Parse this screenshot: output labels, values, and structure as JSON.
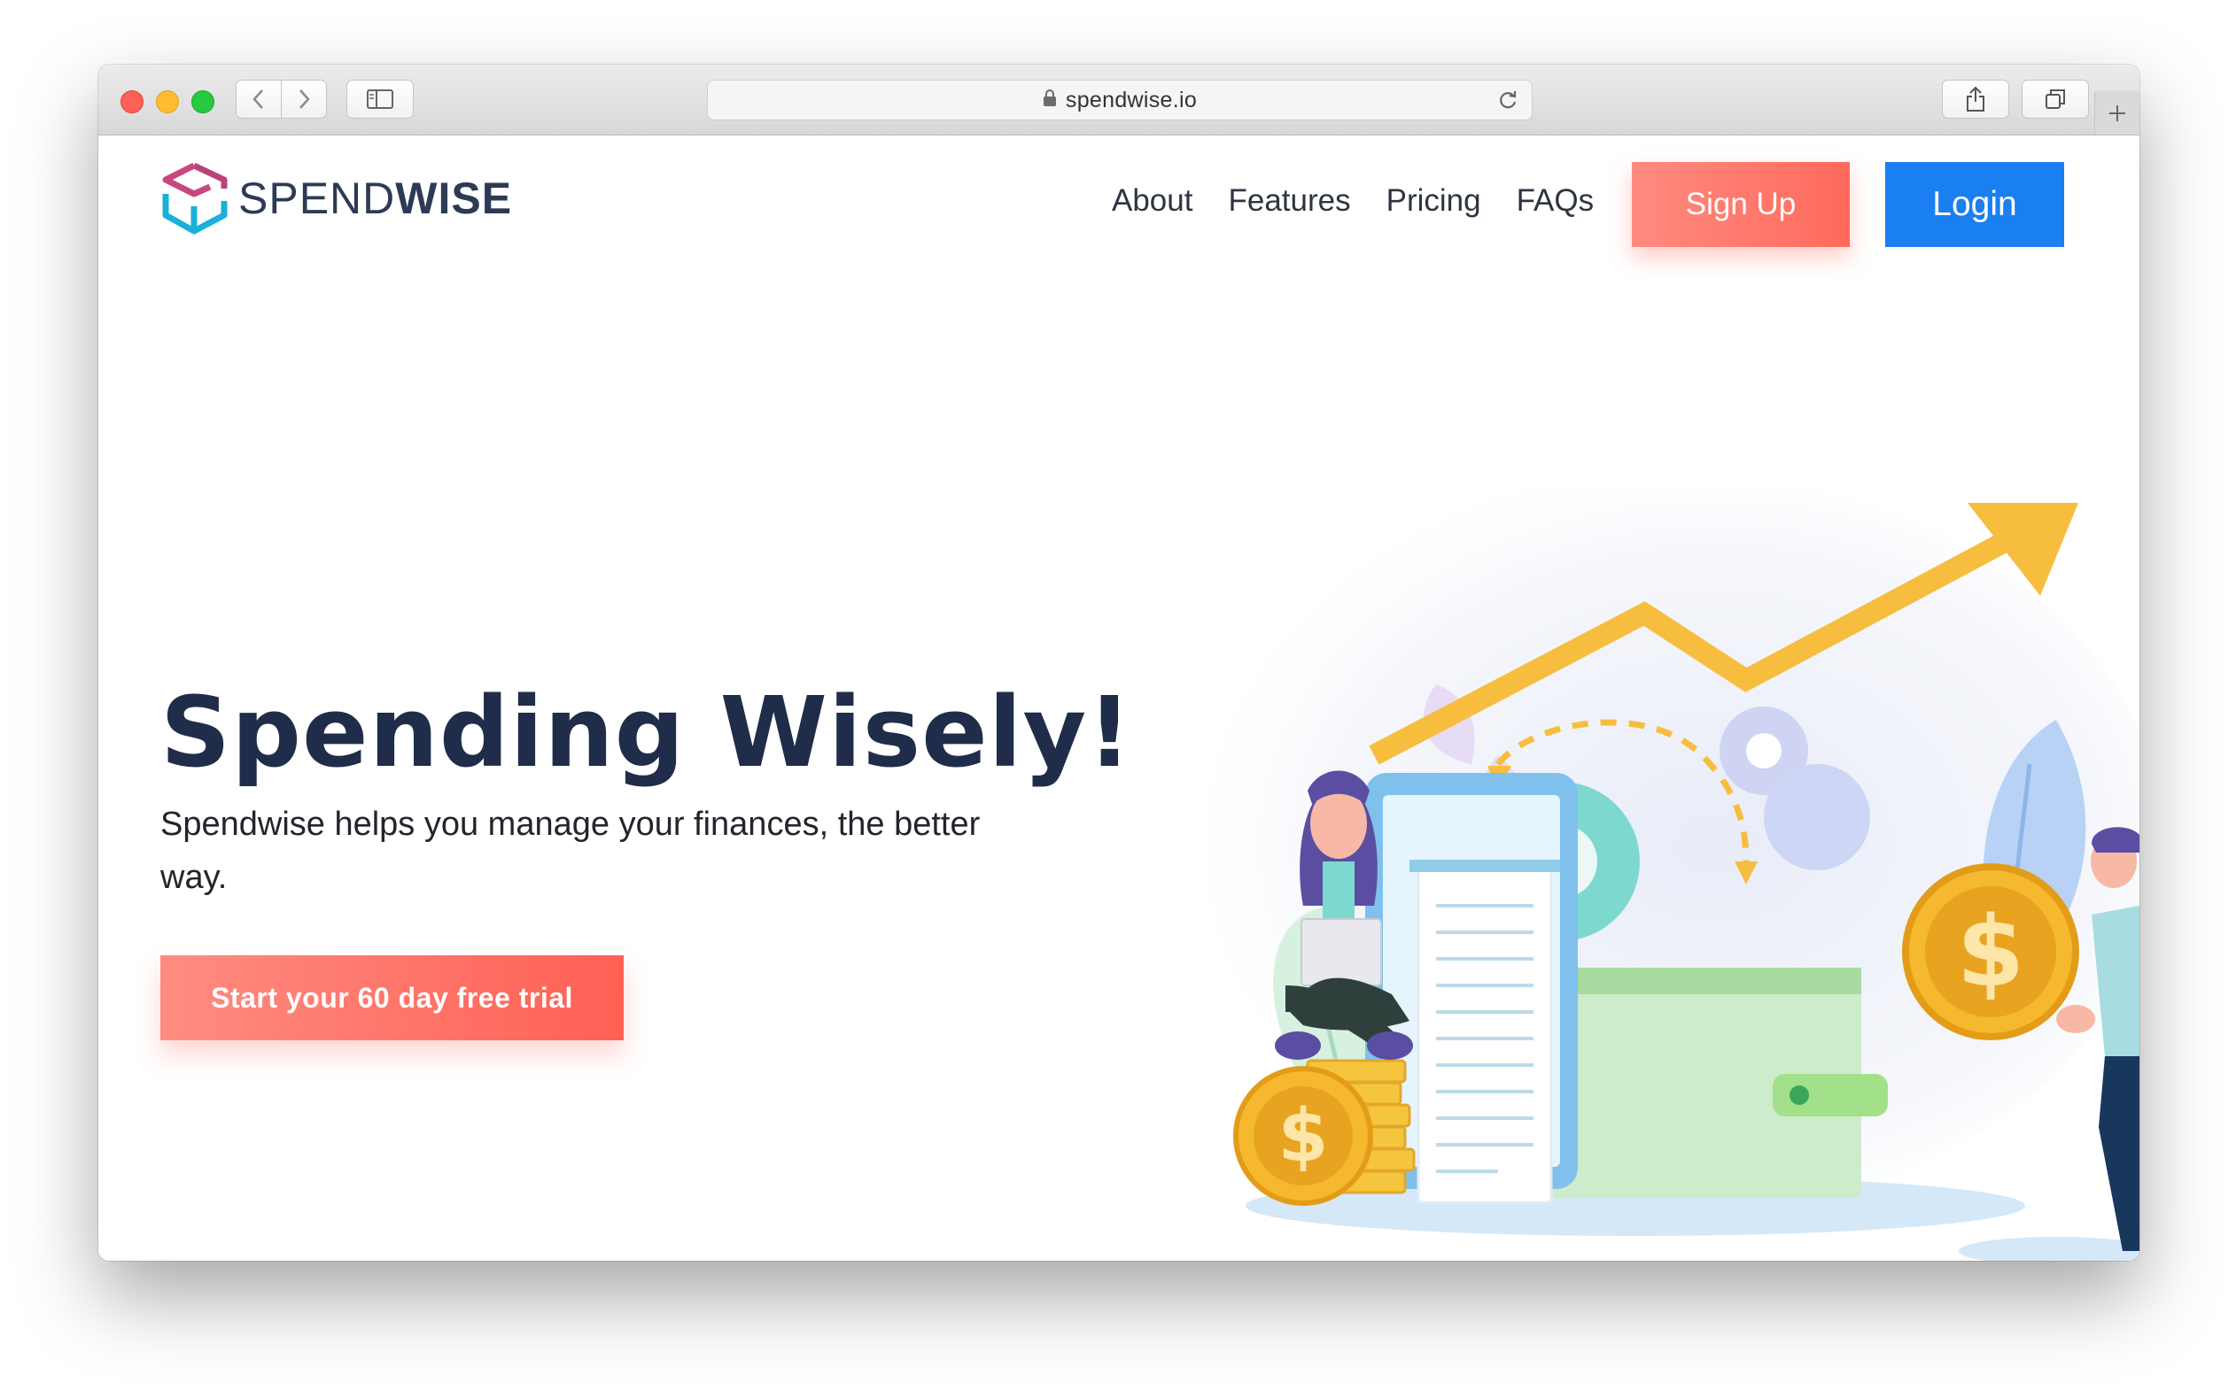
{
  "browser": {
    "url": "spendwise.io"
  },
  "header": {
    "logo_text_light": "SPEND",
    "logo_text_bold": "WISE",
    "nav": [
      "About",
      "Features",
      "Pricing",
      "FAQs"
    ],
    "signup_label": "Sign Up",
    "login_label": "Login"
  },
  "hero": {
    "title": "Spending Wisely!",
    "subtitle": "Spendwise helps you manage your finances, the better way.",
    "cta_label": "Start your 60 day free trial"
  },
  "illustration": {
    "coin_symbol": "$"
  },
  "colors": {
    "brand_navy": "#1f2d4a",
    "accent_coral": "#ff6a5c",
    "login_blue": "#1a7ff0",
    "coin_gold": "#f5b82e"
  },
  "icons": [
    "lock-icon",
    "reload-icon",
    "back-icon",
    "forward-icon",
    "sidebar-icon",
    "share-icon",
    "tabs-icon",
    "plus-icon"
  ]
}
